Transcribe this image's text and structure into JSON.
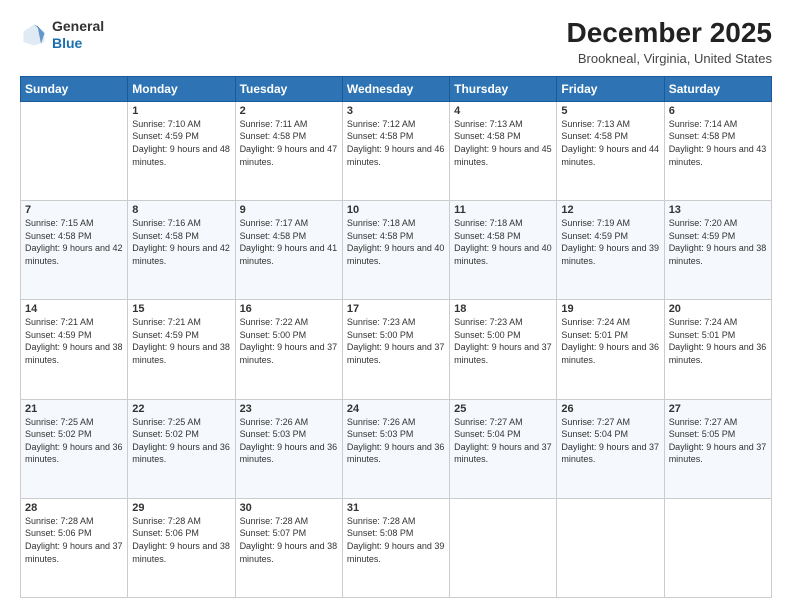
{
  "header": {
    "logo_general": "General",
    "logo_blue": "Blue",
    "month": "December 2025",
    "location": "Brookneal, Virginia, United States"
  },
  "days_of_week": [
    "Sunday",
    "Monday",
    "Tuesday",
    "Wednesday",
    "Thursday",
    "Friday",
    "Saturday"
  ],
  "weeks": [
    [
      {
        "day": "",
        "sunrise": "",
        "sunset": "",
        "daylight": ""
      },
      {
        "day": "1",
        "sunrise": "Sunrise: 7:10 AM",
        "sunset": "Sunset: 4:59 PM",
        "daylight": "Daylight: 9 hours and 48 minutes."
      },
      {
        "day": "2",
        "sunrise": "Sunrise: 7:11 AM",
        "sunset": "Sunset: 4:58 PM",
        "daylight": "Daylight: 9 hours and 47 minutes."
      },
      {
        "day": "3",
        "sunrise": "Sunrise: 7:12 AM",
        "sunset": "Sunset: 4:58 PM",
        "daylight": "Daylight: 9 hours and 46 minutes."
      },
      {
        "day": "4",
        "sunrise": "Sunrise: 7:13 AM",
        "sunset": "Sunset: 4:58 PM",
        "daylight": "Daylight: 9 hours and 45 minutes."
      },
      {
        "day": "5",
        "sunrise": "Sunrise: 7:13 AM",
        "sunset": "Sunset: 4:58 PM",
        "daylight": "Daylight: 9 hours and 44 minutes."
      },
      {
        "day": "6",
        "sunrise": "Sunrise: 7:14 AM",
        "sunset": "Sunset: 4:58 PM",
        "daylight": "Daylight: 9 hours and 43 minutes."
      }
    ],
    [
      {
        "day": "7",
        "sunrise": "Sunrise: 7:15 AM",
        "sunset": "Sunset: 4:58 PM",
        "daylight": "Daylight: 9 hours and 42 minutes."
      },
      {
        "day": "8",
        "sunrise": "Sunrise: 7:16 AM",
        "sunset": "Sunset: 4:58 PM",
        "daylight": "Daylight: 9 hours and 42 minutes."
      },
      {
        "day": "9",
        "sunrise": "Sunrise: 7:17 AM",
        "sunset": "Sunset: 4:58 PM",
        "daylight": "Daylight: 9 hours and 41 minutes."
      },
      {
        "day": "10",
        "sunrise": "Sunrise: 7:18 AM",
        "sunset": "Sunset: 4:58 PM",
        "daylight": "Daylight: 9 hours and 40 minutes."
      },
      {
        "day": "11",
        "sunrise": "Sunrise: 7:18 AM",
        "sunset": "Sunset: 4:58 PM",
        "daylight": "Daylight: 9 hours and 40 minutes."
      },
      {
        "day": "12",
        "sunrise": "Sunrise: 7:19 AM",
        "sunset": "Sunset: 4:59 PM",
        "daylight": "Daylight: 9 hours and 39 minutes."
      },
      {
        "day": "13",
        "sunrise": "Sunrise: 7:20 AM",
        "sunset": "Sunset: 4:59 PM",
        "daylight": "Daylight: 9 hours and 38 minutes."
      }
    ],
    [
      {
        "day": "14",
        "sunrise": "Sunrise: 7:21 AM",
        "sunset": "Sunset: 4:59 PM",
        "daylight": "Daylight: 9 hours and 38 minutes."
      },
      {
        "day": "15",
        "sunrise": "Sunrise: 7:21 AM",
        "sunset": "Sunset: 4:59 PM",
        "daylight": "Daylight: 9 hours and 38 minutes."
      },
      {
        "day": "16",
        "sunrise": "Sunrise: 7:22 AM",
        "sunset": "Sunset: 5:00 PM",
        "daylight": "Daylight: 9 hours and 37 minutes."
      },
      {
        "day": "17",
        "sunrise": "Sunrise: 7:23 AM",
        "sunset": "Sunset: 5:00 PM",
        "daylight": "Daylight: 9 hours and 37 minutes."
      },
      {
        "day": "18",
        "sunrise": "Sunrise: 7:23 AM",
        "sunset": "Sunset: 5:00 PM",
        "daylight": "Daylight: 9 hours and 37 minutes."
      },
      {
        "day": "19",
        "sunrise": "Sunrise: 7:24 AM",
        "sunset": "Sunset: 5:01 PM",
        "daylight": "Daylight: 9 hours and 36 minutes."
      },
      {
        "day": "20",
        "sunrise": "Sunrise: 7:24 AM",
        "sunset": "Sunset: 5:01 PM",
        "daylight": "Daylight: 9 hours and 36 minutes."
      }
    ],
    [
      {
        "day": "21",
        "sunrise": "Sunrise: 7:25 AM",
        "sunset": "Sunset: 5:02 PM",
        "daylight": "Daylight: 9 hours and 36 minutes."
      },
      {
        "day": "22",
        "sunrise": "Sunrise: 7:25 AM",
        "sunset": "Sunset: 5:02 PM",
        "daylight": "Daylight: 9 hours and 36 minutes."
      },
      {
        "day": "23",
        "sunrise": "Sunrise: 7:26 AM",
        "sunset": "Sunset: 5:03 PM",
        "daylight": "Daylight: 9 hours and 36 minutes."
      },
      {
        "day": "24",
        "sunrise": "Sunrise: 7:26 AM",
        "sunset": "Sunset: 5:03 PM",
        "daylight": "Daylight: 9 hours and 36 minutes."
      },
      {
        "day": "25",
        "sunrise": "Sunrise: 7:27 AM",
        "sunset": "Sunset: 5:04 PM",
        "daylight": "Daylight: 9 hours and 37 minutes."
      },
      {
        "day": "26",
        "sunrise": "Sunrise: 7:27 AM",
        "sunset": "Sunset: 5:04 PM",
        "daylight": "Daylight: 9 hours and 37 minutes."
      },
      {
        "day": "27",
        "sunrise": "Sunrise: 7:27 AM",
        "sunset": "Sunset: 5:05 PM",
        "daylight": "Daylight: 9 hours and 37 minutes."
      }
    ],
    [
      {
        "day": "28",
        "sunrise": "Sunrise: 7:28 AM",
        "sunset": "Sunset: 5:06 PM",
        "daylight": "Daylight: 9 hours and 37 minutes."
      },
      {
        "day": "29",
        "sunrise": "Sunrise: 7:28 AM",
        "sunset": "Sunset: 5:06 PM",
        "daylight": "Daylight: 9 hours and 38 minutes."
      },
      {
        "day": "30",
        "sunrise": "Sunrise: 7:28 AM",
        "sunset": "Sunset: 5:07 PM",
        "daylight": "Daylight: 9 hours and 38 minutes."
      },
      {
        "day": "31",
        "sunrise": "Sunrise: 7:28 AM",
        "sunset": "Sunset: 5:08 PM",
        "daylight": "Daylight: 9 hours and 39 minutes."
      },
      {
        "day": "",
        "sunrise": "",
        "sunset": "",
        "daylight": ""
      },
      {
        "day": "",
        "sunrise": "",
        "sunset": "",
        "daylight": ""
      },
      {
        "day": "",
        "sunrise": "",
        "sunset": "",
        "daylight": ""
      }
    ]
  ]
}
